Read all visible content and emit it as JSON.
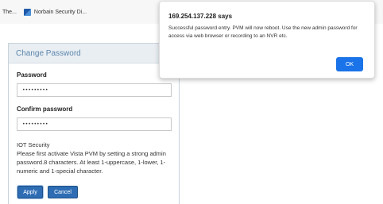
{
  "bookmarks": [
    {
      "label": "The..."
    },
    {
      "label": "Norbain Security Di...",
      "icon": "norbain-favicon-icon"
    }
  ],
  "panel": {
    "title": "Change Password",
    "password_label": "Password",
    "password_value": "•••••••••",
    "confirm_label": "Confirm password",
    "confirm_value": "•••••••••",
    "iot_title": "IOT Security",
    "iot_text": "Please first activate Vista PVM by setting a strong admin password.8 characters. At least 1-uppercase, 1-lower, 1-numeric and 1-special character.",
    "apply_label": "Apply",
    "cancel_label": "Cancel"
  },
  "dialog": {
    "title": "169.254.137.228 says",
    "message": "Successful password entry. PVM will now reboot. Use the new admin password for access via web browser or recording to an NVR etc.",
    "ok_label": "OK"
  },
  "colors": {
    "accent": "#2e6db4",
    "dialog_button": "#1a73e8",
    "panel_header_text": "#5c86ad"
  }
}
